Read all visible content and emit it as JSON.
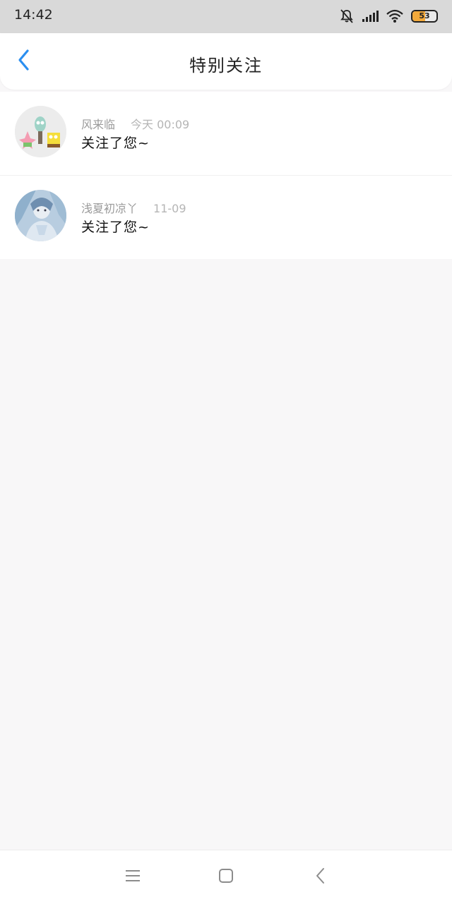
{
  "status_bar": {
    "time": "14:42",
    "battery_level": "53",
    "battery_fraction": 0.53,
    "icons": [
      "bell-muted-icon",
      "signal-icon",
      "wifi-icon",
      "battery-icon"
    ],
    "battery_color": "#f2a93b"
  },
  "header": {
    "title": "特别关注",
    "back_icon": "chevron-left-icon",
    "accent_color": "#2b8ff0"
  },
  "list": {
    "items": [
      {
        "name": "风来临",
        "time": "今天 00:09",
        "message": "关注了您~",
        "avatar_icon": "cartoon-characters-avatar"
      },
      {
        "name": "浅夏初凉丫",
        "time": "11-09",
        "message": "关注了您~",
        "avatar_icon": "anime-girl-avatar"
      }
    ]
  },
  "bottom_nav": {
    "icons": [
      "menu-icon",
      "home-icon",
      "back-icon"
    ]
  }
}
